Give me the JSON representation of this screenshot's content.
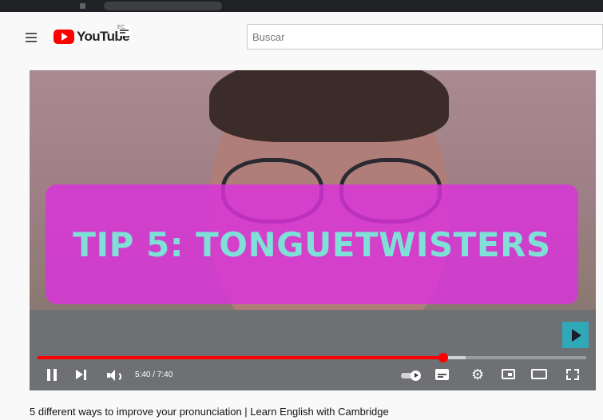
{
  "header": {
    "logo_text": "YouTube",
    "country_code": "EC",
    "search_placeholder": "Buscar"
  },
  "player": {
    "overlay_text": "TIP 5: TONGUETWISTERS",
    "time_display": "5:40 / 7:40",
    "progress_fraction": 0.739,
    "buffered_fraction": 0.78,
    "icons": [
      "pause-icon",
      "next-icon",
      "volume-icon",
      "autoplay-toggle-icon",
      "subtitles-icon",
      "settings-icon",
      "miniplayer-icon",
      "theater-icon",
      "fullscreen-icon"
    ]
  },
  "video": {
    "title": "5 different ways to improve your pronunciation | Learn English with Cambridge"
  },
  "colors": {
    "brand_red": "#ff0000",
    "overlay_magenta": "#dc32dc",
    "overlay_text": "#7ee0d7",
    "next_button": "#2fa9b8"
  }
}
